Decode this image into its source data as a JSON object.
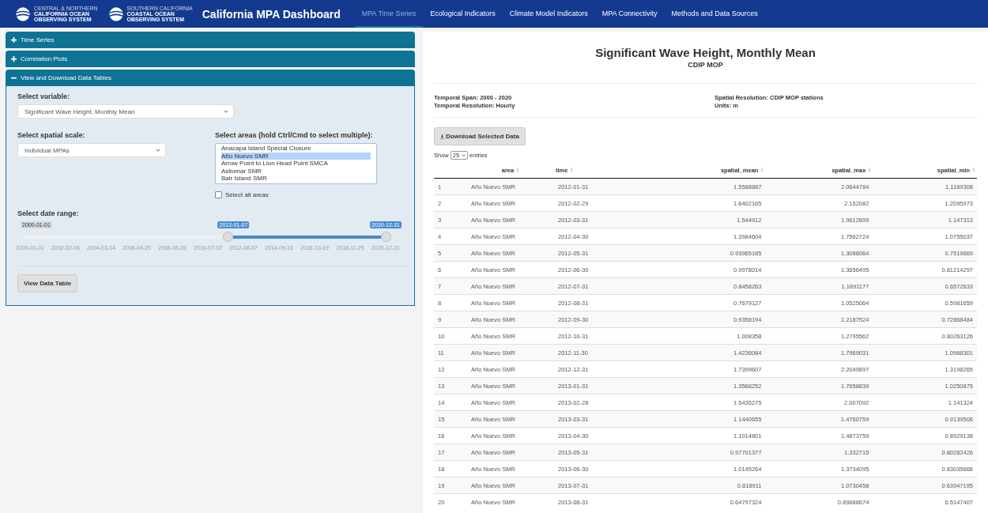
{
  "navbar": {
    "logos": [
      {
        "lines": [
          "CENTRAL & NORTHERN",
          "CALIFORNIA OCEAN",
          "OBSERVING SYSTEM"
        ]
      },
      {
        "lines": [
          "SOUTHERN CALIFORNIA",
          "COASTAL OCEAN",
          "OBSERVING SYSTEM"
        ]
      }
    ],
    "brand": "California MPA Dashboard",
    "tabs": [
      {
        "label": "MPA Time Series",
        "selected": true
      },
      {
        "label": "Ecological Indicators",
        "selected": false
      },
      {
        "label": "Climate Model Indicators",
        "selected": false
      },
      {
        "label": "MPA Connectivity",
        "selected": false
      },
      {
        "label": "Methods and Data Sources",
        "selected": false
      }
    ]
  },
  "sidebar": {
    "panels": [
      {
        "title": "Time Series",
        "expanded": false
      },
      {
        "title": "Correlation Plots",
        "expanded": false
      },
      {
        "title": "View and Download Data Tables",
        "expanded": true
      }
    ],
    "form": {
      "variable_label": "Select variable:",
      "variable_value": "Significant Wave Height, Monthly Mean",
      "scale_label": "Select spatial scale:",
      "scale_value": "Individual MPAs",
      "areas_label": "Select areas (hold Ctrl/Cmd to select multiple):",
      "areas": [
        {
          "label": "Anacapa Island Special Closure",
          "selected": false
        },
        {
          "label": "Año Nuevo SMR",
          "selected": true
        },
        {
          "label": "Arrow Point to Lion Head Point SMCA",
          "selected": false
        },
        {
          "label": "Asilomar SMR",
          "selected": false
        },
        {
          "label": "Bair Island SMR",
          "selected": false
        }
      ],
      "select_all": {
        "label": "Select all areas",
        "checked": false
      },
      "date_label": "Select date range:",
      "slider": {
        "min_label": "2000-01-01",
        "from": {
          "label": "2012-01-07",
          "level": 0.572
        },
        "to": {
          "label": "2020-12-31",
          "level": 1
        },
        "ticks": [
          "2000-01-01",
          "2002-02-06",
          "2004-03-14",
          "2006-04-20",
          "2008-05-26",
          "2010-07-02",
          "2012-08-07",
          "2014-09-13",
          "2016-10-19",
          "2018-11-25",
          "2020-12-31"
        ]
      },
      "button": "View Data Table"
    }
  },
  "main": {
    "title": "Significant Wave Height, Monthly Mean",
    "subtitle": "CDIP MOP",
    "meta": [
      "Temporal Span: 2000 - 2020",
      "Temporal Resolution: Hourly",
      "Spatial Resolution: CDIP MOP stations",
      "Units: m"
    ],
    "download_button": "Download Selected Data",
    "show": {
      "prefix": "Show",
      "value": "25",
      "suffix": "entries"
    },
    "table": {
      "columns": [
        "",
        "area",
        "time",
        "spatial_mean",
        "spatial_max",
        "spatial_min"
      ],
      "rows": [
        [
          "1",
          "Año Nuevo SMR",
          "2012-01-31",
          "1.5588887",
          "2.0644784",
          "1.1169308"
        ],
        [
          "2",
          "Año Nuevo SMR",
          "2012-02-29",
          "1.6402165",
          "2.152082",
          "1.2095973"
        ],
        [
          "3",
          "Año Nuevo SMR",
          "2012-03-31",
          "1.544912",
          "1.9612699",
          "1.147313"
        ],
        [
          "4",
          "Año Nuevo SMR",
          "2012-04-30",
          "1.3984604",
          "1.7562724",
          "1.0755037"
        ],
        [
          "5",
          "Año Nuevo SMR",
          "2012-05-31",
          "0.93965185",
          "1.3088064",
          "0.7519669"
        ],
        [
          "6",
          "Año Nuevo SMR",
          "2012-06-30",
          "0.9978014",
          "1.3656495",
          "0.81214297"
        ],
        [
          "7",
          "Año Nuevo SMR",
          "2012-07-31",
          "0.8458263",
          "1.1691177",
          "0.6572633"
        ],
        [
          "8",
          "Año Nuevo SMR",
          "2012-08-31",
          "0.7679127",
          "1.0525064",
          "0.5981659"
        ],
        [
          "9",
          "Año Nuevo SMR",
          "2012-09-30",
          "0.9358194",
          "1.2187524",
          "0.72868484"
        ],
        [
          "10",
          "Año Nuevo SMR",
          "2012-10-31",
          "1.008358",
          "1.2795562",
          "0.80263126"
        ],
        [
          "11",
          "Año Nuevo SMR",
          "2012-11-30",
          "1.4236084",
          "1.7969031",
          "1.0968301"
        ],
        [
          "12",
          "Año Nuevo SMR",
          "2012-12-31",
          "1.7399607",
          "2.2049897",
          "1.3198265"
        ],
        [
          "13",
          "Año Nuevo SMR",
          "2013-01-31",
          "1.3568252",
          "1.7658839",
          "1.0250875"
        ],
        [
          "14",
          "Año Nuevo SMR",
          "2013-02-28",
          "1.5435275",
          "2.007092",
          "1.141324"
        ],
        [
          "15",
          "Año Nuevo SMR",
          "2013-03-31",
          "1.1440655",
          "1.4760759",
          "0.9139506"
        ],
        [
          "16",
          "Año Nuevo SMR",
          "2013-04-30",
          "1.1014801",
          "1.4873759",
          "0.8929138"
        ],
        [
          "17",
          "Año Nuevo SMR",
          "2013-05-31",
          "0.97701377",
          "1.332715",
          "0.80282426"
        ],
        [
          "18",
          "Año Nuevo SMR",
          "2013-06-30",
          "1.0145264",
          "1.3734095",
          "0.83035666"
        ],
        [
          "19",
          "Año Nuevo SMR",
          "2013-07-31",
          "0.818911",
          "1.0730458",
          "0.63947195"
        ],
        [
          "20",
          "Año Nuevo SMR",
          "2013-08-31",
          "0.64797324",
          "0.89888674",
          "0.5147407"
        ]
      ]
    }
  }
}
